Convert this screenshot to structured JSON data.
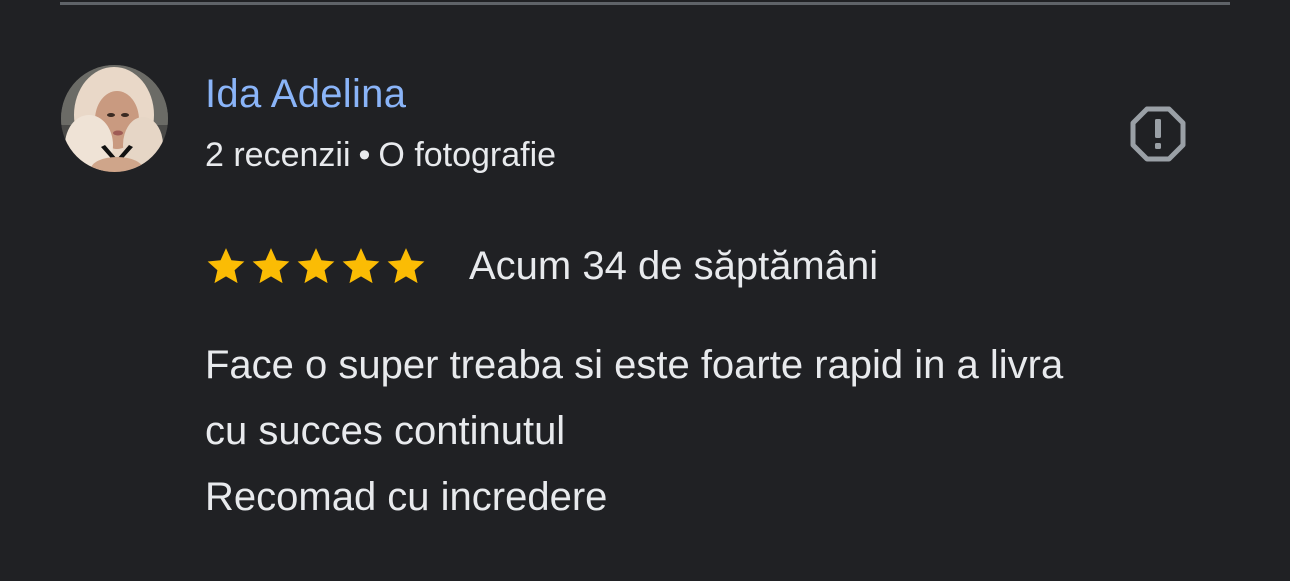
{
  "review": {
    "reviewer": {
      "name": "Ida Adelina",
      "reviews_count": "2 recenzii",
      "separator": "•",
      "photos_count": "O fotografie",
      "avatar_icon": "user-photo"
    },
    "rating": {
      "stars": 5,
      "max_stars": 5,
      "star_icon": "star-icon",
      "star_color": "#fbbc04"
    },
    "date": "Acum 34 de săptămâni",
    "text_lines": [
      "Face o super treaba si este foarte rapid in a livra",
      "cu succes continutul",
      "Recomad cu incredere"
    ],
    "report_icon": "report-flag-icon"
  },
  "colors": {
    "background": "#202124",
    "name": "#8ab4f8",
    "text": "#e8eaed",
    "icon": "#9aa0a6"
  }
}
